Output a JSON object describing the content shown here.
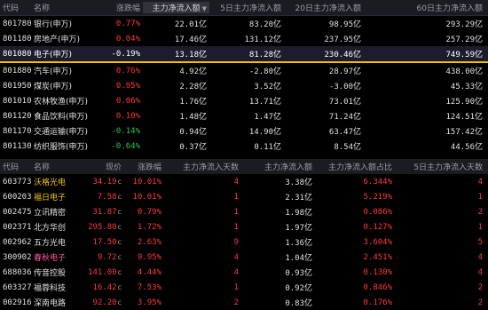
{
  "sector_table": {
    "columns": [
      "代码",
      "名称",
      "涨跌幅",
      "主力净流入额",
      "5日主力净流入额",
      "20日主力净流入额",
      "60日主力净流入额"
    ],
    "sort_marker": "▼",
    "rows": [
      {
        "code": "801780",
        "name": "银行(申万)",
        "change": "0.77%",
        "net": "22.01亿",
        "d5": "83.20亿",
        "d20": "98.95亿",
        "d60": "293.29亿",
        "dir": "up"
      },
      {
        "code": "801180",
        "name": "房地产(申万)",
        "change": "0.04%",
        "net": "17.46亿",
        "d5": "131.12亿",
        "d20": "237.95亿",
        "d60": "257.29亿",
        "dir": "up"
      },
      {
        "code": "801080",
        "name": "电子(申万)",
        "change": "-0.19%",
        "net": "13.18亿",
        "d5": "81.28亿",
        "d20": "230.46亿",
        "d60": "749.59亿",
        "dir": "down"
      },
      {
        "code": "801880",
        "name": "汽车(申万)",
        "change": "0.76%",
        "net": "4.92亿",
        "d5": "-2.80亿",
        "d20": "28.97亿",
        "d60": "438.00亿",
        "dir": "down"
      },
      {
        "code": "801950",
        "name": "煤炭(申万)",
        "change": "0.95%",
        "net": "2.28亿",
        "d5": "3.52亿",
        "d20": "-3.00亿",
        "d60": "45.33亿",
        "dir": "up"
      },
      {
        "code": "801010",
        "name": "农林牧渔(申万)",
        "change": "0.06%",
        "net": "1.76亿",
        "d5": "13.71亿",
        "d20": "73.01亿",
        "d60": "125.90亿",
        "dir": "down"
      },
      {
        "code": "801120",
        "name": "食品饮料(申万)",
        "change": "0.10%",
        "net": "1.48亿",
        "d5": "1.47亿",
        "d20": "71.24亿",
        "d60": "124.51亿",
        "dir": "down"
      },
      {
        "code": "801170",
        "name": "交通运输(申万)",
        "change": "-0.14%",
        "net": "0.94亿",
        "d5": "14.90亿",
        "d20": "63.47亿",
        "d60": "157.42亿",
        "dir": "down"
      },
      {
        "code": "801130",
        "name": "纺织服饰(申万)",
        "change": "-0.64%",
        "net": "0.37亿",
        "d5": "0.11亿",
        "d20": "8.54亿",
        "d60": "44.56亿",
        "dir": "down"
      }
    ]
  },
  "stock_table": {
    "columns": [
      "代码",
      "名称",
      "现价",
      "涨跌幅",
      "主力净流入天数",
      "主力净流入额",
      "主力净流入额占比",
      "5日主力净流入天数"
    ],
    "rows": [
      {
        "code": "603773",
        "name": "沃格光电",
        "price": "34.19",
        "badge": "c",
        "change": "10.01%",
        "days": "4",
        "net": "3.38亿",
        "ratio": "6.344%",
        "d5": "4",
        "name_color": "y",
        "dir": "up"
      },
      {
        "code": "600203",
        "name": "福日电子",
        "price": "7.58",
        "badge": "c",
        "change": "10.01%",
        "days": "1",
        "net": "2.31亿",
        "ratio": "5.219%",
        "d5": "1",
        "name_color": "y",
        "dir": "up"
      },
      {
        "code": "002475",
        "name": "立讯精密",
        "price": "31.87",
        "badge": "c",
        "change": "0.79%",
        "days": "1",
        "net": "1.98亿",
        "ratio": "0.086%",
        "d5": "2",
        "name_color": "w",
        "dir": "up"
      },
      {
        "code": "002371",
        "name": "北方华创",
        "price": "295.80",
        "badge": "c",
        "change": "1.72%",
        "days": "1",
        "net": "1.97亿",
        "ratio": "0.127%",
        "d5": "1",
        "name_color": "w",
        "dir": "up"
      },
      {
        "code": "002962",
        "name": "五方光电",
        "price": "17.50",
        "badge": "c",
        "change": "2.63%",
        "days": "9",
        "net": "1.36亿",
        "ratio": "3.604%",
        "d5": "5",
        "name_color": "w",
        "dir": "up"
      },
      {
        "code": "300902",
        "name": "春秋电子",
        "price": "9.72",
        "badge": "c",
        "change": "9.95%",
        "days": "4",
        "net": "1.04亿",
        "ratio": "2.451%",
        "d5": "4",
        "name_color": "p",
        "dir": "up"
      },
      {
        "code": "688036",
        "name": "传音控股",
        "price": "141.00",
        "badge": "c",
        "change": "4.44%",
        "days": "4",
        "net": "0.93亿",
        "ratio": "0.130%",
        "d5": "4",
        "name_color": "w",
        "dir": "up"
      },
      {
        "code": "603327",
        "name": "福蓉科技",
        "price": "16.42",
        "badge": "c",
        "change": "7.53%",
        "days": "1",
        "net": "0.92亿",
        "ratio": "0.846%",
        "d5": "2",
        "name_color": "w",
        "dir": "up"
      },
      {
        "code": "002916",
        "name": "深南电路",
        "price": "92.20",
        "badge": "c",
        "change": "3.95%",
        "days": "2",
        "net": "0.83亿",
        "ratio": "0.176%",
        "d5": "2",
        "name_color": "w",
        "dir": "up"
      }
    ]
  },
  "colors": {
    "up": "#ff3b3b",
    "down": "#28c850",
    "highlight": "#f2c000",
    "background": "#000000"
  }
}
